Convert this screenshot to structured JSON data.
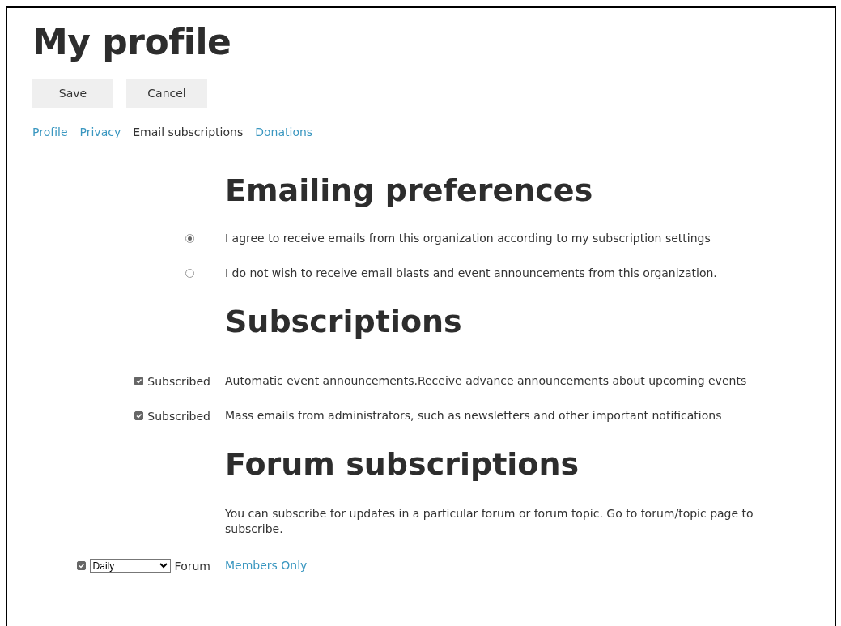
{
  "title": "My profile",
  "buttons": [
    "Save",
    "Cancel"
  ],
  "tabs": [
    {
      "label": "Profile",
      "selected": false
    },
    {
      "label": "Privacy",
      "selected": false
    },
    {
      "label": "Email subscriptions",
      "selected": true
    },
    {
      "label": "Donations",
      "selected": false
    }
  ],
  "emailing": {
    "heading": "Emailing preferences",
    "options": [
      {
        "label": "I agree to receive emails from this organization according to my subscription settings",
        "selected": true
      },
      {
        "label": "I do not wish to receive email blasts and event announcements from this organization.",
        "selected": false
      }
    ]
  },
  "subscriptions": {
    "heading": "Subscriptions",
    "items": [
      {
        "checked": true,
        "status": "Subscribed",
        "description": "Automatic event announcements.Receive advance announcements about upcoming events"
      },
      {
        "checked": true,
        "status": "Subscribed",
        "description": "Mass emails from administrators, such as newsletters and other important notifications"
      }
    ]
  },
  "forum_subscriptions": {
    "heading": "Forum subscriptions",
    "note": "You can subscribe for updates in a particular forum or forum topic. Go to forum/topic page to subscribe.",
    "items": [
      {
        "checked": true,
        "frequency": "Daily",
        "type": "Forum",
        "name": "Members Only"
      }
    ]
  }
}
